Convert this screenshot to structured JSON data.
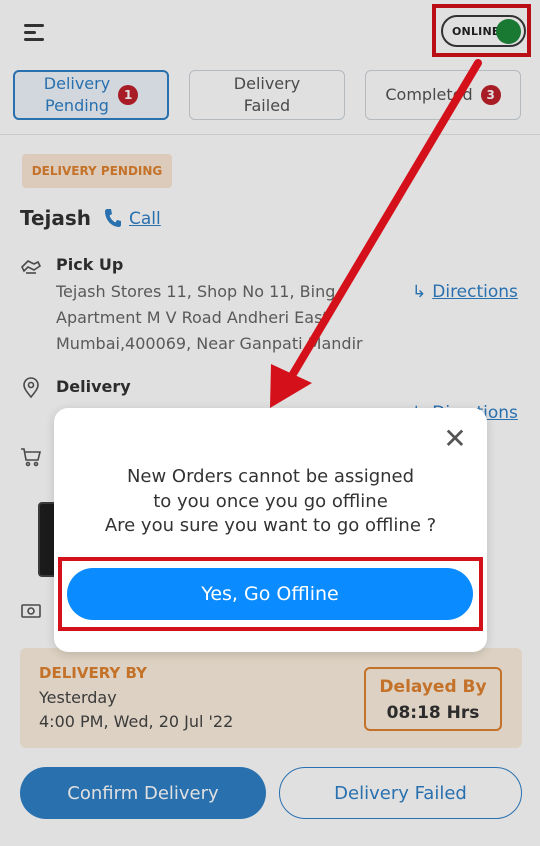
{
  "header": {
    "toggle_label": "ONLINE"
  },
  "tabs": [
    {
      "label_line1": "Delivery",
      "label_line2": "Pending",
      "badge": "1"
    },
    {
      "label_line1": "Delivery",
      "label_line2": "Failed"
    },
    {
      "label": "Completed",
      "badge": "3"
    }
  ],
  "order": {
    "status": "DELIVERY PENDING",
    "customer": "Tejash",
    "call_label": "Call",
    "pickup": {
      "label": "Pick Up",
      "address_lines": [
        "Tejash Stores 11, Shop No 11, Bing",
        "Apartment M V Road Andheri East",
        "Mumbai,400069, Near Ganpati Mandir"
      ],
      "directions_label": "Directions"
    },
    "delivery": {
      "label": "Delivery",
      "directions_label": "Directions"
    },
    "deliver_by": {
      "label": "DELIVERY BY",
      "day": "Yesterday",
      "datetime": "4:00 PM, Wed, 20 Jul '22"
    },
    "delayed": {
      "label": "Delayed By",
      "value": "08:18 Hrs"
    }
  },
  "actions": {
    "confirm": "Confirm Delivery",
    "failed": "Delivery Failed"
  },
  "modal": {
    "message_lines": [
      "New Orders cannot be assigned",
      "to you once you go offline",
      "Are you sure you want to go offline ?"
    ],
    "confirm_label": "Yes, Go Offline"
  },
  "colors": {
    "accent": "#2f80c8",
    "primary_button": "#0a8bff",
    "highlight": "#d4111a",
    "pending": "#e0822f",
    "online": "#1d8a3a"
  }
}
